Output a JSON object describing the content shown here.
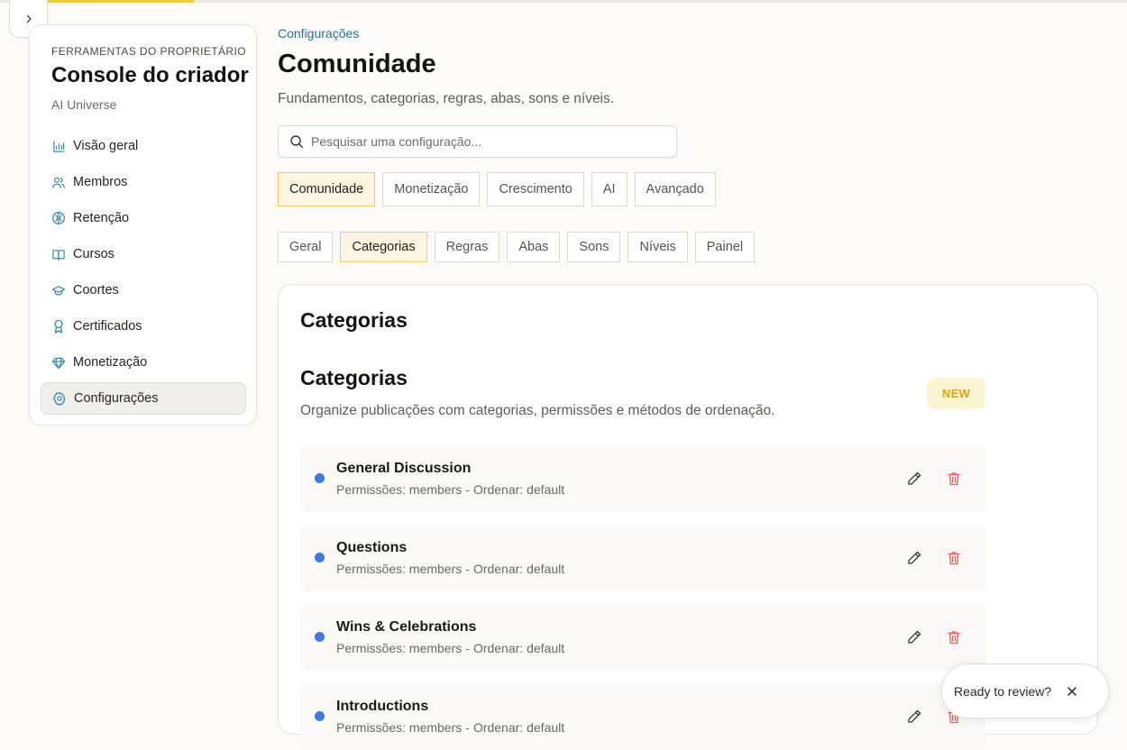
{
  "sidebar": {
    "eyebrow": "FERRAMENTAS DO PROPRIETÁRIO",
    "title": "Console do criador",
    "subtitle": "AI Universe",
    "items": [
      {
        "label": "Visão geral",
        "icon": "bar-chart-icon"
      },
      {
        "label": "Membros",
        "icon": "users-icon"
      },
      {
        "label": "Retenção",
        "icon": "brain-icon"
      },
      {
        "label": "Cursos",
        "icon": "book-icon"
      },
      {
        "label": "Coortes",
        "icon": "graduation-cap-icon"
      },
      {
        "label": "Certificados",
        "icon": "award-icon"
      },
      {
        "label": "Monetização",
        "icon": "gem-icon"
      },
      {
        "label": "Configurações",
        "icon": "gear-icon",
        "active": true
      }
    ]
  },
  "header": {
    "breadcrumb": "Configurações",
    "title": "Comunidade",
    "description": "Fundamentos, categorias, regras, abas, sons e níveis."
  },
  "search": {
    "placeholder": "Pesquisar uma configuração..."
  },
  "primary_tabs": [
    "Comunidade",
    "Monetização",
    "Crescimento",
    "AI",
    "Avançado"
  ],
  "primary_active": "Comunidade",
  "secondary_tabs": [
    "Geral",
    "Categorias",
    "Regras",
    "Abas",
    "Sons",
    "Níveis",
    "Painel"
  ],
  "secondary_active": "Categorias",
  "panel": {
    "title": "Categorias",
    "section_title": "Categorias",
    "section_description": "Organize publicações com categorias, permissões e métodos de ordenação.",
    "badge": "NEW",
    "categories": [
      {
        "name": "General Discussion",
        "permissions": "Permissões: members",
        "sort": "Ordenar: default"
      },
      {
        "name": "Questions",
        "permissions": "Permissões: members",
        "sort": "Ordenar: default"
      },
      {
        "name": "Wins & Celebrations",
        "permissions": "Permissões: members",
        "sort": "Ordenar: default"
      },
      {
        "name": "Introductions",
        "permissions": "Permissões: members",
        "sort": "Ordenar: default"
      }
    ],
    "separator": "-"
  },
  "review_prompt": {
    "label": "Ready to review?"
  },
  "colors": {
    "accent": "#f2c744",
    "active_tab_bg": "#fdf6e1",
    "active_tab_border": "#efcb63",
    "link": "#2d6f91",
    "category_dot": "#3b7be4",
    "delete": "#e25a5a",
    "badge_text": "#d8a416"
  }
}
